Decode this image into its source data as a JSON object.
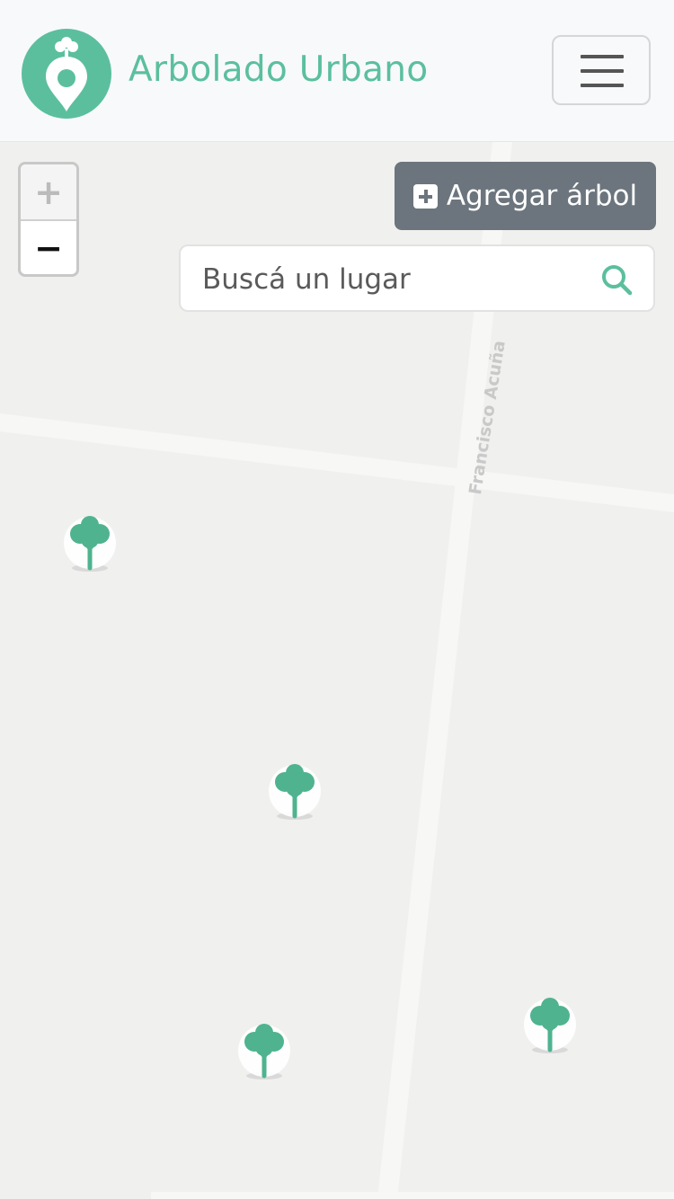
{
  "header": {
    "brand": "Arbolado Urbano",
    "logo_icon": "tree-location-pin-icon",
    "menu_icon": "hamburger-menu-icon"
  },
  "map": {
    "zoom_in_label": "+",
    "zoom_out_label": "−",
    "add_tree_label": "Agregar árbol",
    "add_tree_icon": "plus-square-icon",
    "search": {
      "placeholder": "Buscá un lugar",
      "value": "",
      "icon": "search-icon"
    },
    "street_label": "Francisco Acuña de",
    "tree_markers": 4
  },
  "colors": {
    "brand_green": "#5bbf9e",
    "marker_green": "#4fb38f",
    "button_gray": "#6c757d",
    "map_background": "#f0f0ee"
  }
}
